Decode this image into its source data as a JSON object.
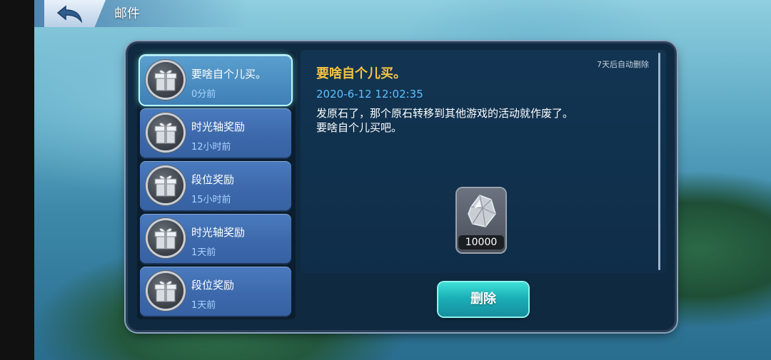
{
  "header": {
    "title": "邮件",
    "back_icon": "back-arrow-icon"
  },
  "mail_list": [
    {
      "title": "要啥自个儿买。",
      "time": "0分前",
      "selected": true
    },
    {
      "title": "时光轴奖励",
      "time": "12小时前",
      "selected": false
    },
    {
      "title": "段位奖励",
      "time": "15小时前",
      "selected": false
    },
    {
      "title": "时光轴奖励",
      "time": "1天前",
      "selected": false
    },
    {
      "title": "段位奖励",
      "time": "1天前",
      "selected": false
    }
  ],
  "detail": {
    "auto_delete_note": "7天后自动删除",
    "title": "要啥自个儿买。",
    "date": "2020-6-12 12:02:35",
    "body_line1": "发原石了，那个原石转移到其他游戏的活动就作废了。",
    "body_line2": "要啥自个儿买吧。",
    "reward": {
      "icon": "gem-icon",
      "count": "10000"
    },
    "delete_label": "删除"
  },
  "colors": {
    "title_gold": "#f6c542",
    "date_blue": "#5ec2ff",
    "button_teal": "#1bb0b8"
  }
}
